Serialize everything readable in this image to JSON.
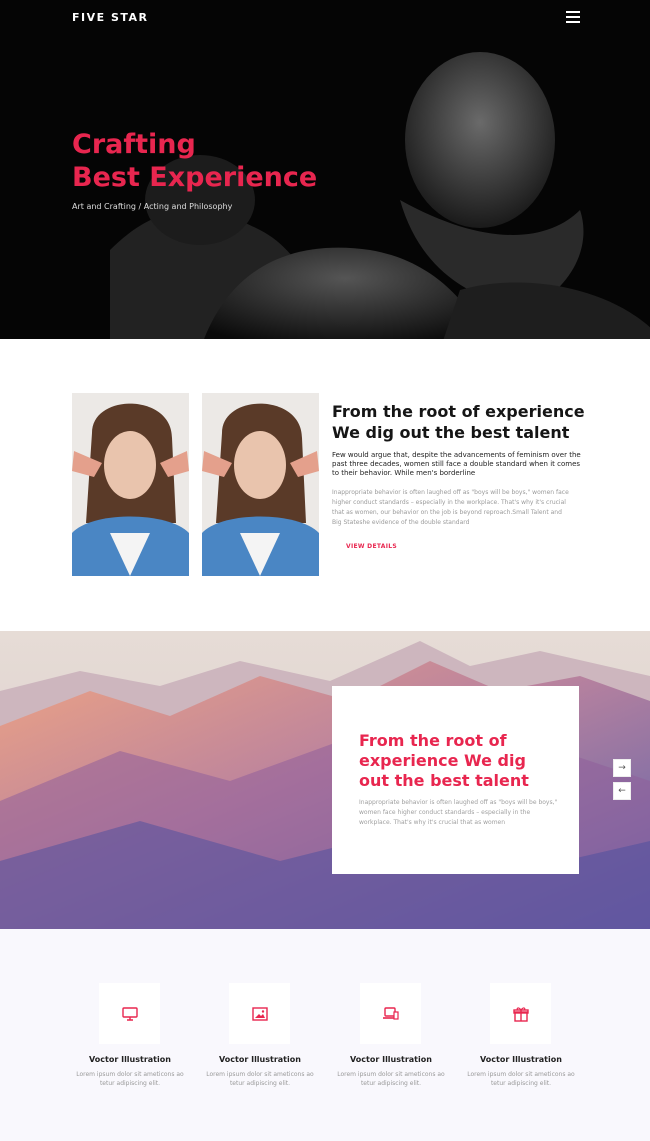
{
  "brand": {
    "name": "FIVE STAR"
  },
  "hero": {
    "title_line1": "Crafting",
    "title_line2": "Best Experience",
    "subtitle": "Art and Crafting / Acting and Philosophy"
  },
  "about": {
    "title_line1": "From the root of experience",
    "title_line2": "We dig out the best talent",
    "lead": "Few would argue that, despite the advancements of feminism over the past three decades, women still face a double standard when it comes to their behavior. While men's borderline",
    "body": "Inappropriate behavior is often laughed off as \"boys will be boys,\" women face higher conduct standards – especially in the workplace. That's why it's crucial that as women, our behavior on the job is beyond reproach.Small Talent and Big Stateshe evidence of the double standard",
    "cta": "VIEW DETAILS"
  },
  "slider": {
    "card_title": "From the root of experience We dig out the best talent",
    "card_body": "Inappropriate behavior is often laughed off as \"boys will be boys,\" women face higher conduct standards – especially in the workplace. That's why it's crucial that as women",
    "next_icon": "→",
    "prev_icon": "←"
  },
  "features": [
    {
      "icon": "monitor-icon",
      "title": "Voctor Illustration",
      "body_line1": "Lorem ipsum dolor sit ameticons ao",
      "body_line2": "tetur adipiscing elit."
    },
    {
      "icon": "picture-icon",
      "title": "Voctor Illustration",
      "body_line1": "Lorem ipsum dolor sit ameticons ao",
      "body_line2": "tetur adipiscing elit."
    },
    {
      "icon": "devices-icon",
      "title": "Voctor Illustration",
      "body_line1": "Lorem ipsum dolor sit ameticons ao",
      "body_line2": "tetur adipiscing elit."
    },
    {
      "icon": "gift-icon",
      "title": "Voctor Illustration",
      "body_line1": "Lorem ipsum dolor sit ameticons ao",
      "body_line2": "tetur adipiscing elit."
    }
  ],
  "colors": {
    "accent": "#e8264f",
    "hero_bg": "#050505",
    "features_bg": "#f9f8fd"
  }
}
